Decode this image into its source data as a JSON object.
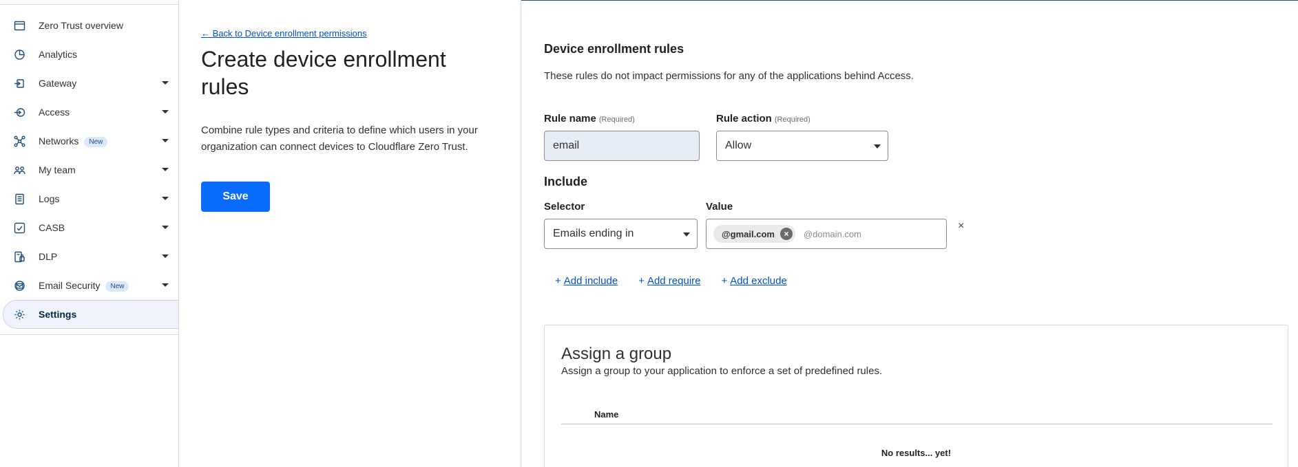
{
  "sidebar": {
    "items": [
      {
        "label": "Zero Trust overview",
        "icon": "browser-window-icon",
        "has_caret": false
      },
      {
        "label": "Analytics",
        "icon": "pie-chart-icon",
        "has_caret": false
      },
      {
        "label": "Gateway",
        "icon": "gateway-icon",
        "has_caret": true
      },
      {
        "label": "Access",
        "icon": "access-icon",
        "has_caret": true
      },
      {
        "label": "Networks",
        "icon": "network-icon",
        "has_caret": true,
        "badge": "New"
      },
      {
        "label": "My team",
        "icon": "team-icon",
        "has_caret": true
      },
      {
        "label": "Logs",
        "icon": "logs-icon",
        "has_caret": true
      },
      {
        "label": "CASB",
        "icon": "casb-icon",
        "has_caret": true
      },
      {
        "label": "DLP",
        "icon": "dlp-icon",
        "has_caret": true
      },
      {
        "label": "Email Security",
        "icon": "email-security-icon",
        "has_caret": true,
        "badge": "New"
      },
      {
        "label": "Settings",
        "icon": "gear-icon",
        "has_caret": false,
        "active": true
      }
    ]
  },
  "left": {
    "back_link": "← Back to Device enrollment permissions",
    "title": "Create device enrollment rules",
    "description": "Combine rule types and criteria to define which users in your organization can connect devices to Cloudflare Zero Trust.",
    "save_label": "Save"
  },
  "rules": {
    "title": "Device enrollment rules",
    "description": "These rules do not impact permissions for any of the applications behind Access.",
    "rule_name_label": "Rule name",
    "rule_name_required": "(Required)",
    "rule_name_value": "email",
    "rule_action_label": "Rule action",
    "rule_action_required": "(Required)",
    "rule_action_value": "Allow",
    "include_title": "Include",
    "selector_label": "Selector",
    "selector_value": "Emails ending in",
    "value_label": "Value",
    "value_tag": "@gmail.com",
    "value_tag_remove": "×",
    "value_placeholder": "@domain.com",
    "remove_row": "×",
    "add_include": "Add include",
    "add_require": "Add require",
    "add_exclude": "Add exclude",
    "plus": "+"
  },
  "group": {
    "title": "Assign a group",
    "description": "Assign a group to your application to enforce a set of predefined rules.",
    "column_name": "Name",
    "empty_text": "No results... yet!"
  },
  "colors": {
    "accent": "#0a6cff",
    "link": "#0051c3",
    "icon": "#1f4e79"
  }
}
